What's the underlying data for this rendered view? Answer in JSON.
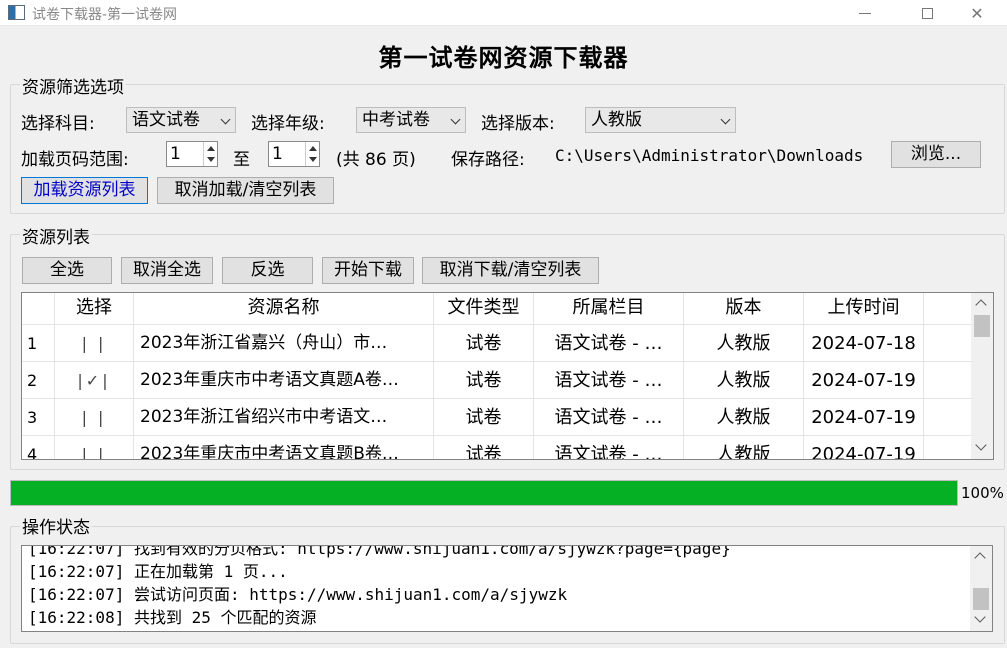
{
  "window": {
    "title": "试卷下载器-第一试卷网"
  },
  "main_title": "第一试卷网资源下载器",
  "filter": {
    "group_label": "资源筛选选项",
    "subject_label": "选择科目:",
    "subject_value": "语文试卷",
    "grade_label": "选择年级:",
    "grade_value": "中考试卷",
    "version_label": "选择版本:",
    "version_value": "人教版",
    "page_range_label": "加载页码范围:",
    "page_from": "1",
    "to_label": "至",
    "page_to": "1",
    "total_pages": "(共 86 页)",
    "save_path_label": "保存路径:",
    "save_path": "C:\\Users\\Administrator\\Downloads",
    "browse_button": "浏览...",
    "load_button": "加载资源列表",
    "cancel_load_button": "取消加载/清空列表"
  },
  "resources": {
    "group_label": "资源列表",
    "buttons": {
      "select_all": "全选",
      "deselect_all": "取消全选",
      "invert": "反选",
      "start_download": "开始下载",
      "cancel_download": "取消下载/清空列表"
    },
    "columns": [
      "",
      "选择",
      "资源名称",
      "文件类型",
      "所属栏目",
      "版本",
      "上传时间"
    ],
    "rows": [
      {
        "index": "1",
        "checked": false,
        "check_glyph": "| |",
        "name": "2023年浙江省嘉兴（舟山）市…",
        "type": "试卷",
        "column": "语文试卷 - …",
        "version": "人教版",
        "date": "2024-07-18"
      },
      {
        "index": "2",
        "checked": true,
        "check_glyph": "|✓|",
        "name": "2023年重庆市中考语文真题A卷…",
        "type": "试卷",
        "column": "语文试卷 - …",
        "version": "人教版",
        "date": "2024-07-19"
      },
      {
        "index": "3",
        "checked": false,
        "check_glyph": "| |",
        "name": "2023年浙江省绍兴市中考语文…",
        "type": "试卷",
        "column": "语文试卷 - …",
        "version": "人教版",
        "date": "2024-07-19"
      },
      {
        "index": "4",
        "checked": false,
        "check_glyph": "| |",
        "name": "2023年重庆市中考语文真题B卷…",
        "type": "试卷",
        "column": "语文试卷 - …",
        "version": "人教版",
        "date": "2024-07-19"
      }
    ]
  },
  "progress": {
    "value": 1.0,
    "label": "100%",
    "color": "#06b025"
  },
  "status": {
    "group_label": "操作状态",
    "lines": [
      "[16:22:07] 找到有效的分页格式: https://www.shijuan1.com/a/sjywzk?page={page}",
      "[16:22:07] 正在加载第 1 页...",
      "[16:22:07] 尝试访问页面: https://www.shijuan1.com/a/sjywzk",
      "[16:22:08] 共找到 25 个匹配的资源"
    ]
  }
}
